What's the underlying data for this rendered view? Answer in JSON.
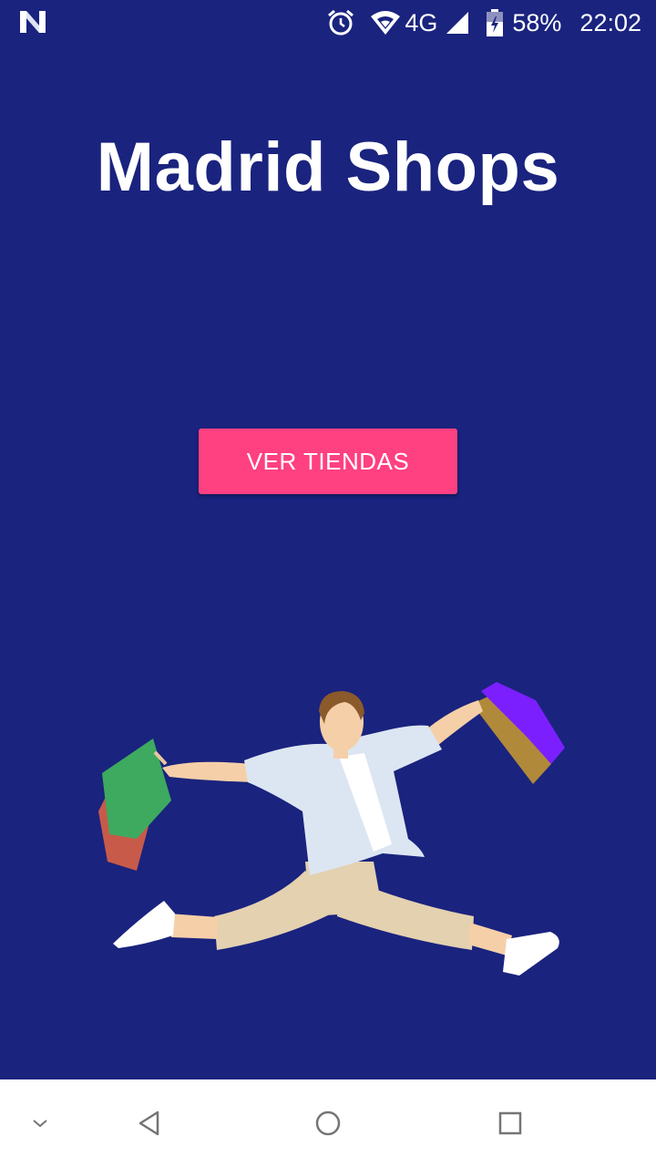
{
  "status_bar": {
    "network_type": "4G",
    "battery_percent": "58%",
    "time": "22:02",
    "icons": [
      "notification-n-icon",
      "alarm-icon",
      "wifi-icon",
      "signal-icon",
      "battery-icon"
    ]
  },
  "main": {
    "title": "Madrid Shops",
    "button_label": "VER TIENDAS",
    "illustration": "jumping-shopper-illustration"
  },
  "nav_bar": {
    "icons": [
      "collapse-chevron-icon",
      "back-icon",
      "home-icon",
      "recents-icon"
    ]
  },
  "colors": {
    "background": "#1a237e",
    "accent": "#ff4081",
    "nav_bar": "#ffffff"
  }
}
